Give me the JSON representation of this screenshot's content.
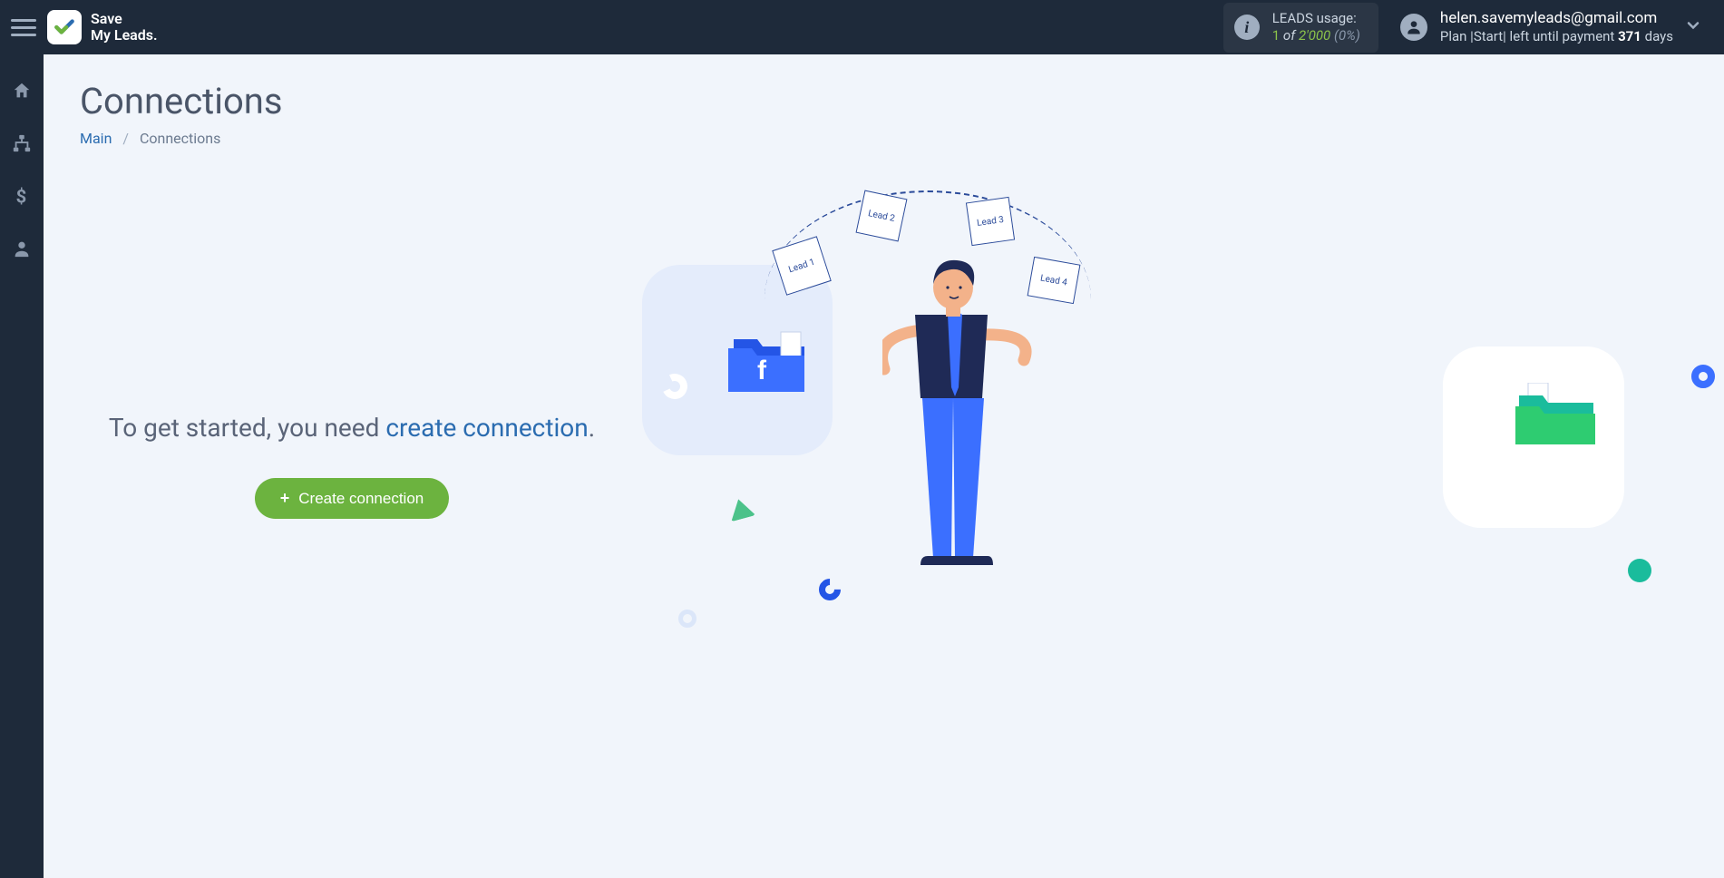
{
  "header": {
    "logo": {
      "line1": "Save",
      "line2": "My Leads."
    },
    "usage": {
      "label": "LEADS usage:",
      "current": "1",
      "of": "of",
      "limit": "2'000",
      "percent": "(0%)"
    },
    "account": {
      "email": "helen.savemyleads@gmail.com",
      "plan_prefix": "Plan",
      "plan_name": "|Start|",
      "plan_mid": "left until payment",
      "plan_days": "371",
      "plan_suffix": "days"
    }
  },
  "page": {
    "title": "Connections",
    "breadcrumb": {
      "root": "Main",
      "current": "Connections"
    }
  },
  "cta": {
    "prefix": "To get started, you need ",
    "link": "create connection",
    "suffix": ".",
    "button": "Create connection"
  },
  "illustration": {
    "papers": {
      "p1": "Lead 1",
      "p2": "Lead 2",
      "p3": "Lead 3",
      "p4": "Lead 4"
    },
    "fb_letter": "f"
  }
}
